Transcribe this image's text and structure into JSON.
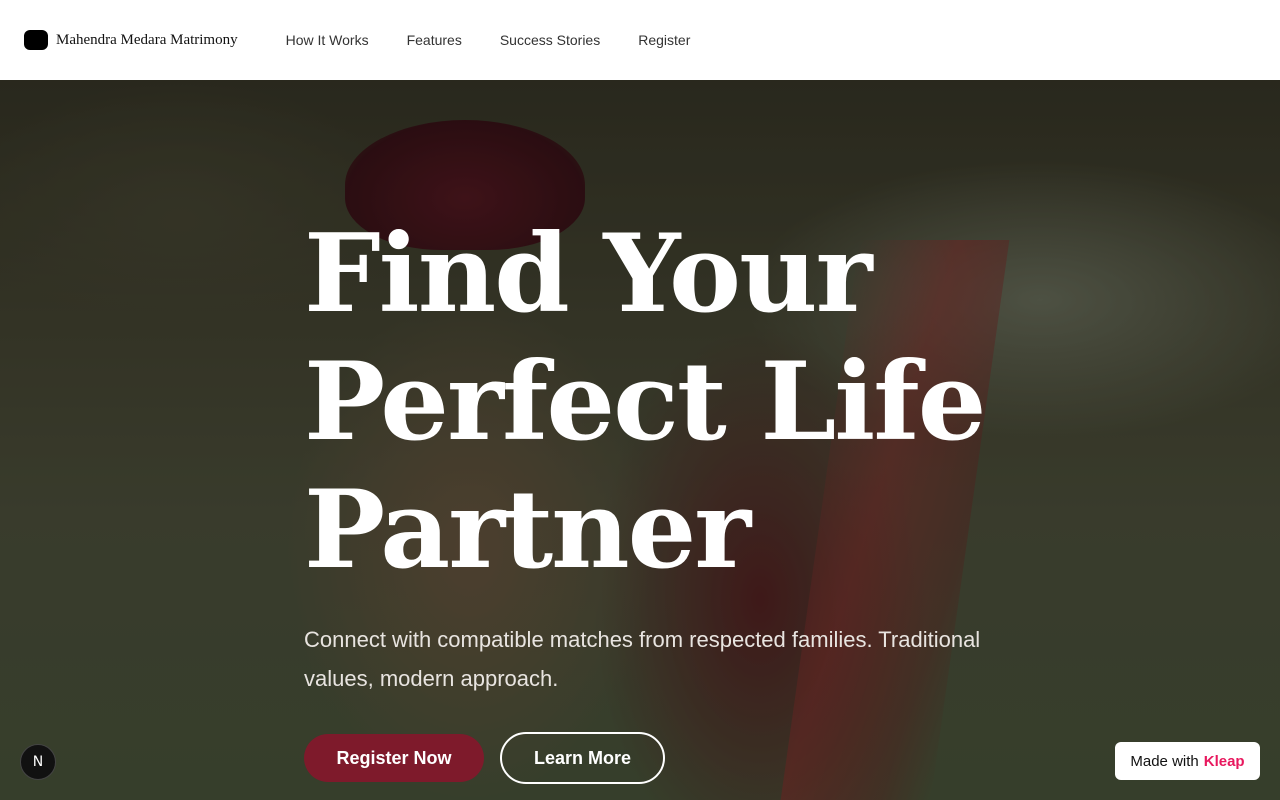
{
  "colors": {
    "primary": "#7e1a2b",
    "kleap_brand": "#e8185e",
    "header_bg": "#ffffff",
    "hero_text": "#ffffff"
  },
  "header": {
    "brand_name": "Mahendra Medara Matrimony",
    "nav": [
      {
        "label": "How It Works"
      },
      {
        "label": "Features"
      },
      {
        "label": "Success Stories"
      },
      {
        "label": "Register"
      }
    ]
  },
  "hero": {
    "title": "Find Your Perfect Life Partner",
    "subtitle": "Connect with compatible matches from respected families. Traditional values, modern approach.",
    "primary_cta": "Register Now",
    "secondary_cta": "Learn More"
  },
  "next_badge": {
    "letter": "N"
  },
  "made_with": {
    "prefix": "Made with",
    "brand": "Kleap"
  }
}
